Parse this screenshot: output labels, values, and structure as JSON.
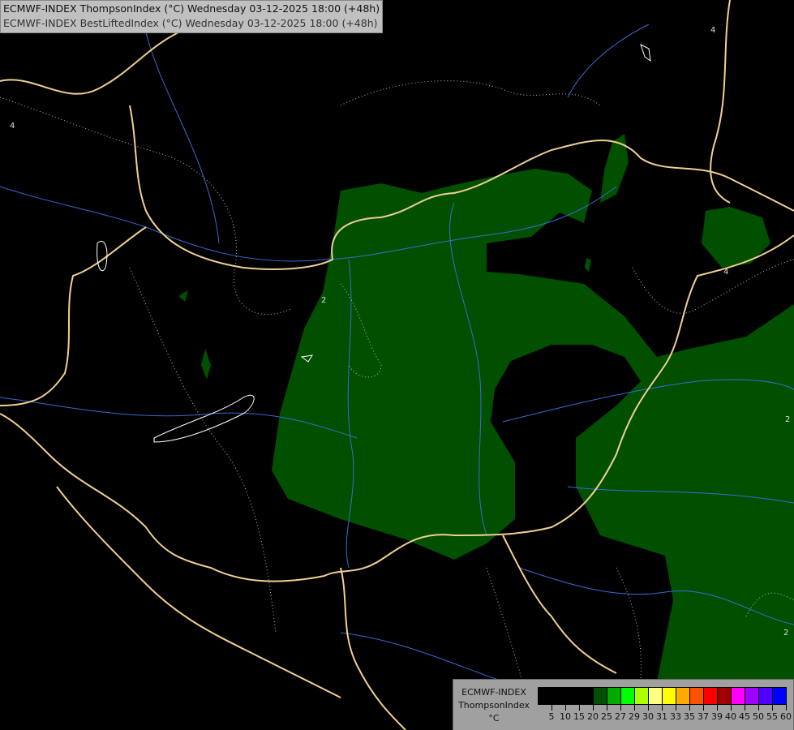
{
  "header": {
    "line1": "ECMWF-INDEX ThompsonIndex (°C) Wednesday 03-12-2025 18:00 (+48h)",
    "line2": "ECMWF-INDEX BestLiftedIndex (°C) Wednesday 03-12-2025 18:00 (+48h)"
  },
  "contour_labels": [
    "4",
    "2",
    "2",
    "4",
    "2",
    "4"
  ],
  "legend": {
    "source": "ECMWF-INDEX",
    "parameter": "ThompsonIndex",
    "unit": "°C",
    "ticks": [
      "5",
      "10",
      "15",
      "20",
      "25",
      "27",
      "29",
      "30",
      "31",
      "33",
      "35",
      "37",
      "39",
      "40",
      "45",
      "50",
      "55",
      "60"
    ],
    "colors": [
      "#000000",
      "#000000",
      "#000000",
      "#000000",
      "#005000",
      "#00aa00",
      "#00ff00",
      "#aaff00",
      "#ffff80",
      "#ffff00",
      "#ffaa00",
      "#ff5000",
      "#ff0000",
      "#a00000",
      "#ff00ff",
      "#a000ff",
      "#5000ff",
      "#0000ff"
    ]
  },
  "colors": {
    "fill_20_25": "#005000",
    "border": "#f0d090",
    "river": "#3a6ad0",
    "background": "#000000"
  }
}
